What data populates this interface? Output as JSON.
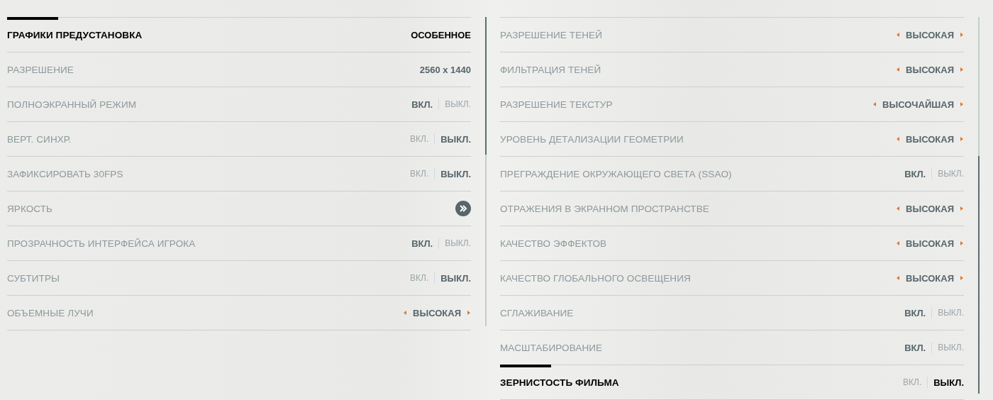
{
  "left": {
    "rows": [
      {
        "label": "ГРАФИКИ ПРЕДУСТАНОВКА",
        "kind": "value",
        "selected": true,
        "value": "ОСОБЕННОЕ"
      },
      {
        "label": "РАЗРЕШЕНИЕ",
        "kind": "value",
        "selected": false,
        "value": "2560 x 1440"
      },
      {
        "label": "ПОЛНОЭКРАННЫЙ РЕЖИМ",
        "kind": "toggle",
        "selected": false,
        "options": [
          {
            "label": "ВКЛ.",
            "selected": true
          },
          {
            "label": "ВЫКЛ.",
            "selected": false
          }
        ]
      },
      {
        "label": "ВЕРТ. СИНХР.",
        "kind": "toggle",
        "selected": false,
        "options": [
          {
            "label": "ВКЛ.",
            "selected": false
          },
          {
            "label": "ВЫКЛ.",
            "selected": true
          }
        ]
      },
      {
        "label": "ЗАФИКСИРОВАТЬ 30FPS",
        "kind": "toggle",
        "selected": false,
        "options": [
          {
            "label": "ВКЛ.",
            "selected": false
          },
          {
            "label": "ВЫКЛ.",
            "selected": true
          }
        ]
      },
      {
        "label": "ЯРКОСТЬ",
        "kind": "link",
        "selected": false
      },
      {
        "label": "ПРОЗРАЧНОСТЬ ИНТЕРФЕЙСА ИГРОКА",
        "kind": "toggle",
        "selected": false,
        "options": [
          {
            "label": "ВКЛ.",
            "selected": true
          },
          {
            "label": "ВЫКЛ.",
            "selected": false
          }
        ]
      },
      {
        "label": "СУБТИТРЫ",
        "kind": "toggle",
        "selected": false,
        "options": [
          {
            "label": "ВКЛ.",
            "selected": false
          },
          {
            "label": "ВЫКЛ.",
            "selected": true
          }
        ]
      },
      {
        "label": "ОБЪЕМНЫЕ ЛУЧИ",
        "kind": "select",
        "selected": false,
        "value": "ВЫСОКАЯ"
      }
    ]
  },
  "right": {
    "rows": [
      {
        "label": "РАЗРЕШЕНИЕ ТЕНЕЙ",
        "kind": "select",
        "selected": false,
        "value": "ВЫСОКАЯ"
      },
      {
        "label": "ФИЛЬТРАЦИЯ ТЕНЕЙ",
        "kind": "select",
        "selected": false,
        "value": "ВЫСОКАЯ"
      },
      {
        "label": "РАЗРЕШЕНИЕ ТЕКСТУР",
        "kind": "select",
        "selected": false,
        "value": "ВЫСОЧАЙШАЯ"
      },
      {
        "label": "УРОВЕНЬ ДЕТАЛИЗАЦИИ ГЕОМЕТРИИ",
        "kind": "select",
        "selected": false,
        "value": "ВЫСОКАЯ"
      },
      {
        "label": "ПРЕГРАЖДЕНИЕ ОКРУЖАЮЩЕГО СВЕТА (SSAO)",
        "kind": "toggle",
        "selected": false,
        "options": [
          {
            "label": "ВКЛ.",
            "selected": true
          },
          {
            "label": "ВЫКЛ.",
            "selected": false
          }
        ]
      },
      {
        "label": "ОТРАЖЕНИЯ В ЭКРАННОМ ПРОСТРАНСТВЕ",
        "kind": "select",
        "selected": false,
        "value": "ВЫСОКАЯ"
      },
      {
        "label": "КАЧЕСТВО ЭФФЕКТОВ",
        "kind": "select",
        "selected": false,
        "value": "ВЫСОКАЯ"
      },
      {
        "label": "КАЧЕСТВО ГЛОБАЛЬНОГО ОСВЕЩЕНИЯ",
        "kind": "select",
        "selected": false,
        "value": "ВЫСОКАЯ"
      },
      {
        "label": "СГЛАЖИВАНИЕ",
        "kind": "toggle",
        "selected": false,
        "options": [
          {
            "label": "ВКЛ.",
            "selected": true
          },
          {
            "label": "ВЫКЛ.",
            "selected": false
          }
        ]
      },
      {
        "label": "МАСШТАБИРОВАНИЕ",
        "kind": "toggle",
        "selected": false,
        "options": [
          {
            "label": "ВКЛ.",
            "selected": true
          },
          {
            "label": "ВЫКЛ.",
            "selected": false
          }
        ]
      },
      {
        "label": "ЗЕРНИСТОСТЬ ФИЛЬМА",
        "kind": "toggle",
        "selected": true,
        "options": [
          {
            "label": "ВКЛ.",
            "selected": false
          },
          {
            "label": "ВЫКЛ.",
            "selected": true
          }
        ]
      }
    ]
  }
}
